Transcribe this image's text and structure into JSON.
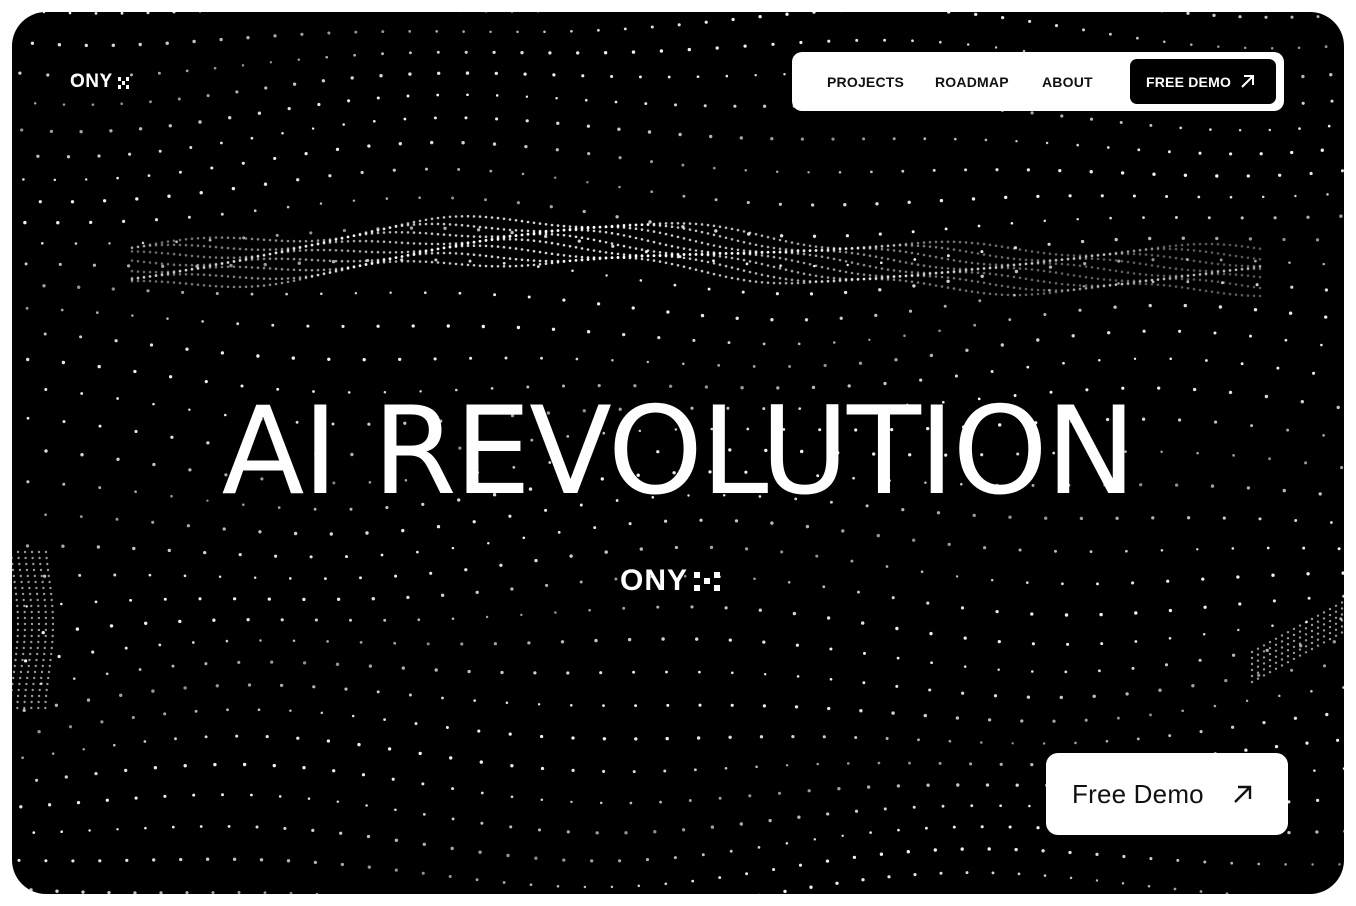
{
  "brand": {
    "name": "ONY",
    "mark_icon": "dot-grid-logo-icon"
  },
  "nav": {
    "links": [
      {
        "label": "PROJECTS"
      },
      {
        "label": "ROADMAP"
      },
      {
        "label": "ABOUT"
      }
    ],
    "cta_label": "FREE DEMO",
    "cta_icon": "arrow-up-right-icon"
  },
  "hero": {
    "title": "AI REVOLUTION",
    "background": "particle-wave-dots"
  },
  "cta": {
    "label": "Free Demo",
    "icon": "arrow-up-right-icon"
  },
  "colors": {
    "background": "#000000",
    "foreground": "#ffffff",
    "page": "#ffffff"
  }
}
